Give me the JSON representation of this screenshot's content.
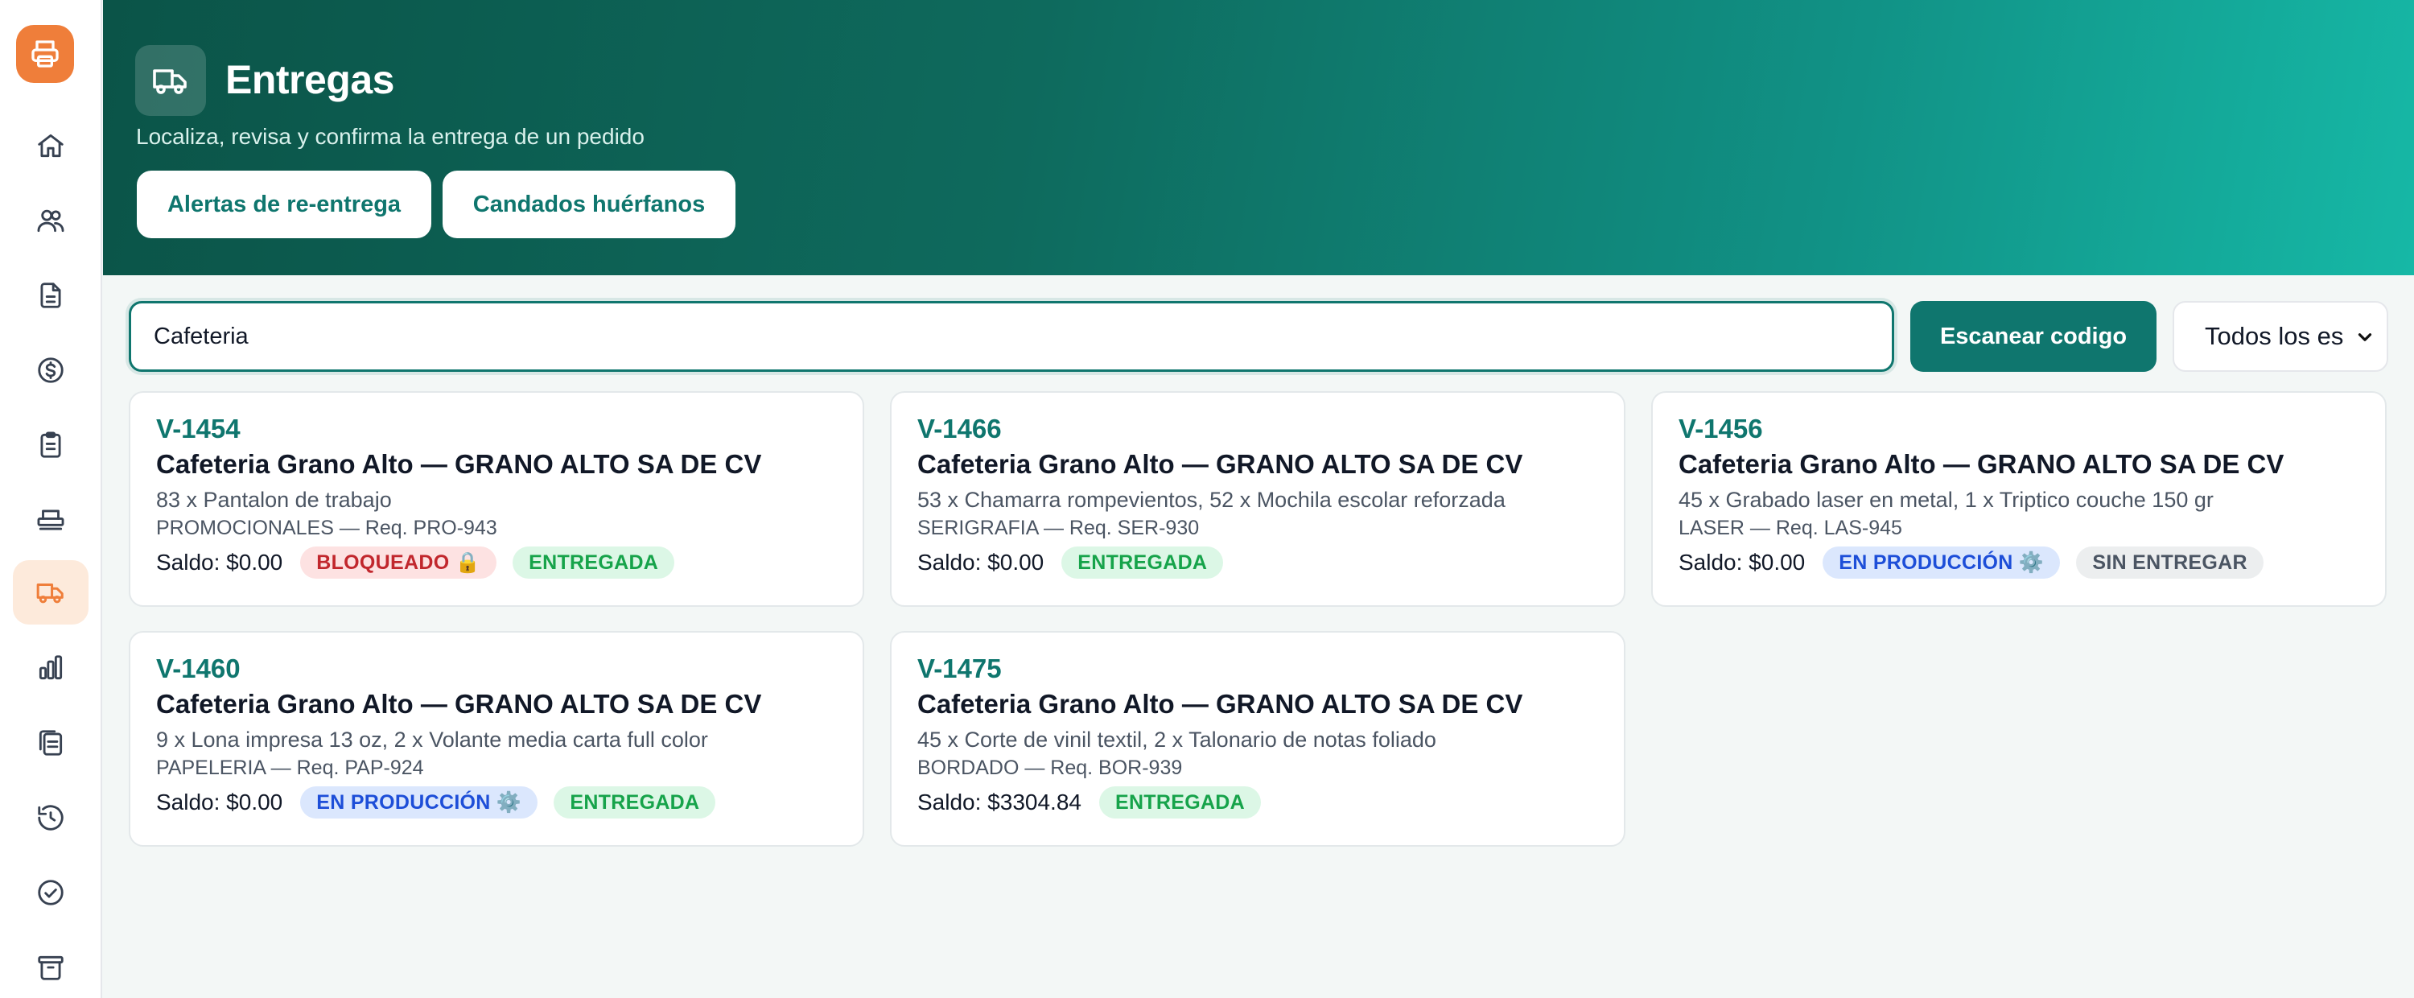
{
  "header": {
    "title": "Entregas",
    "subtitle": "Localiza, revisa y confirma la entrega de un pedido",
    "btn_alerts": "Alertas de re-entrega",
    "btn_locks": "Candados huérfanos"
  },
  "toolbar": {
    "search_value": "Cafeteria",
    "scan_label": "Escanear codigo",
    "filter_selected": "Todos los es"
  },
  "colors": {
    "brand_orange": "#ef7e3a",
    "brand_teal": "#0f766e"
  },
  "sidebar": {
    "logo_icon": "printer-icon",
    "items": [
      {
        "icon": "home-icon"
      },
      {
        "icon": "users-icon"
      },
      {
        "icon": "document-icon"
      },
      {
        "icon": "dollar-icon"
      },
      {
        "icon": "clipboard-list-icon"
      },
      {
        "icon": "printer-machine-icon"
      },
      {
        "icon": "truck-icon",
        "active": true
      },
      {
        "icon": "bar-chart-icon"
      },
      {
        "icon": "clipboard-copy-icon"
      },
      {
        "icon": "history-icon"
      },
      {
        "icon": "check-circle-icon"
      },
      {
        "icon": "archive-icon"
      }
    ]
  },
  "cards": [
    {
      "id": "V-1454",
      "client": "Cafeteria Grano Alto — GRANO ALTO SA DE CV",
      "items": "83 x Pantalon de trabajo",
      "dept": "PROMOCIONALES — Req. PRO-943",
      "saldo": "Saldo: $0.00",
      "badge1": "BLOQUEADO 🔒",
      "badge2": "ENTREGADA"
    },
    {
      "id": "V-1466",
      "client": "Cafeteria Grano Alto — GRANO ALTO SA DE CV",
      "items": "53 x Chamarra rompevientos, 52 x Mochila escolar reforzada",
      "dept": "SERIGRAFIA — Req. SER-930",
      "saldo": "Saldo: $0.00",
      "badge1": "ENTREGADA"
    },
    {
      "id": "V-1456",
      "client": "Cafeteria Grano Alto — GRANO ALTO SA DE CV",
      "items": "45 x Grabado laser en metal, 1 x Triptico couche 150 gr",
      "dept": "LASER — Req. LAS-945",
      "saldo": "Saldo: $0.00",
      "badge1": "EN PRODUCCIÓN ⚙️",
      "badge2": "SIN ENTREGAR"
    },
    {
      "id": "V-1460",
      "client": "Cafeteria Grano Alto — GRANO ALTO SA DE CV",
      "items": "9 x Lona impresa 13 oz, 2 x Volante media carta full color",
      "dept": "PAPELERIA — Req. PAP-924",
      "saldo": "Saldo: $0.00",
      "badge1": "EN PRODUCCIÓN ⚙️",
      "badge2": "ENTREGADA"
    },
    {
      "id": "V-1475",
      "client": "Cafeteria Grano Alto — GRANO ALTO SA DE CV",
      "items": "45 x Corte de vinil textil, 2 x Talonario de notas foliado",
      "dept": "BORDADO — Req. BOR-939",
      "saldo": "Saldo: $3304.84",
      "badge1": "ENTREGADA"
    }
  ]
}
